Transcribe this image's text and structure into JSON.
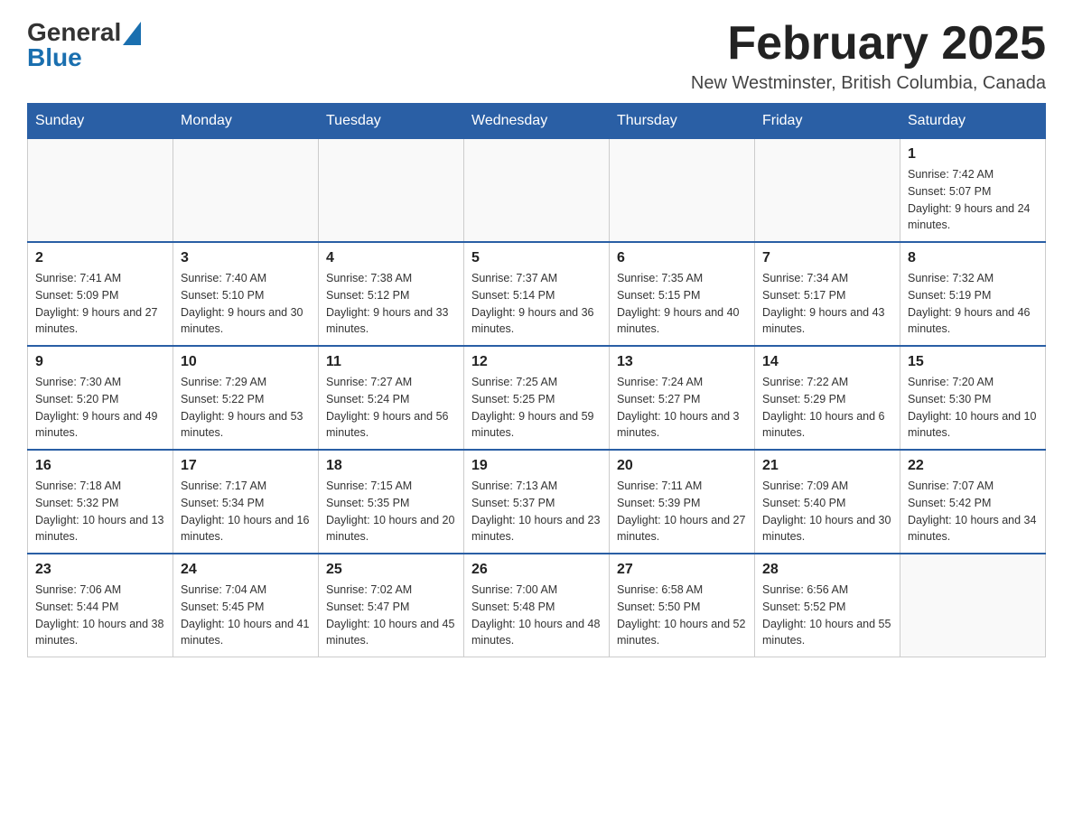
{
  "header": {
    "logo_general": "General",
    "logo_blue": "Blue",
    "title": "February 2025",
    "location": "New Westminster, British Columbia, Canada"
  },
  "days_of_week": [
    "Sunday",
    "Monday",
    "Tuesday",
    "Wednesday",
    "Thursday",
    "Friday",
    "Saturday"
  ],
  "weeks": [
    {
      "days": [
        {
          "num": "",
          "info": ""
        },
        {
          "num": "",
          "info": ""
        },
        {
          "num": "",
          "info": ""
        },
        {
          "num": "",
          "info": ""
        },
        {
          "num": "",
          "info": ""
        },
        {
          "num": "",
          "info": ""
        },
        {
          "num": "1",
          "info": "Sunrise: 7:42 AM\nSunset: 5:07 PM\nDaylight: 9 hours and 24 minutes."
        }
      ]
    },
    {
      "days": [
        {
          "num": "2",
          "info": "Sunrise: 7:41 AM\nSunset: 5:09 PM\nDaylight: 9 hours and 27 minutes."
        },
        {
          "num": "3",
          "info": "Sunrise: 7:40 AM\nSunset: 5:10 PM\nDaylight: 9 hours and 30 minutes."
        },
        {
          "num": "4",
          "info": "Sunrise: 7:38 AM\nSunset: 5:12 PM\nDaylight: 9 hours and 33 minutes."
        },
        {
          "num": "5",
          "info": "Sunrise: 7:37 AM\nSunset: 5:14 PM\nDaylight: 9 hours and 36 minutes."
        },
        {
          "num": "6",
          "info": "Sunrise: 7:35 AM\nSunset: 5:15 PM\nDaylight: 9 hours and 40 minutes."
        },
        {
          "num": "7",
          "info": "Sunrise: 7:34 AM\nSunset: 5:17 PM\nDaylight: 9 hours and 43 minutes."
        },
        {
          "num": "8",
          "info": "Sunrise: 7:32 AM\nSunset: 5:19 PM\nDaylight: 9 hours and 46 minutes."
        }
      ]
    },
    {
      "days": [
        {
          "num": "9",
          "info": "Sunrise: 7:30 AM\nSunset: 5:20 PM\nDaylight: 9 hours and 49 minutes."
        },
        {
          "num": "10",
          "info": "Sunrise: 7:29 AM\nSunset: 5:22 PM\nDaylight: 9 hours and 53 minutes."
        },
        {
          "num": "11",
          "info": "Sunrise: 7:27 AM\nSunset: 5:24 PM\nDaylight: 9 hours and 56 minutes."
        },
        {
          "num": "12",
          "info": "Sunrise: 7:25 AM\nSunset: 5:25 PM\nDaylight: 9 hours and 59 minutes."
        },
        {
          "num": "13",
          "info": "Sunrise: 7:24 AM\nSunset: 5:27 PM\nDaylight: 10 hours and 3 minutes."
        },
        {
          "num": "14",
          "info": "Sunrise: 7:22 AM\nSunset: 5:29 PM\nDaylight: 10 hours and 6 minutes."
        },
        {
          "num": "15",
          "info": "Sunrise: 7:20 AM\nSunset: 5:30 PM\nDaylight: 10 hours and 10 minutes."
        }
      ]
    },
    {
      "days": [
        {
          "num": "16",
          "info": "Sunrise: 7:18 AM\nSunset: 5:32 PM\nDaylight: 10 hours and 13 minutes."
        },
        {
          "num": "17",
          "info": "Sunrise: 7:17 AM\nSunset: 5:34 PM\nDaylight: 10 hours and 16 minutes."
        },
        {
          "num": "18",
          "info": "Sunrise: 7:15 AM\nSunset: 5:35 PM\nDaylight: 10 hours and 20 minutes."
        },
        {
          "num": "19",
          "info": "Sunrise: 7:13 AM\nSunset: 5:37 PM\nDaylight: 10 hours and 23 minutes."
        },
        {
          "num": "20",
          "info": "Sunrise: 7:11 AM\nSunset: 5:39 PM\nDaylight: 10 hours and 27 minutes."
        },
        {
          "num": "21",
          "info": "Sunrise: 7:09 AM\nSunset: 5:40 PM\nDaylight: 10 hours and 30 minutes."
        },
        {
          "num": "22",
          "info": "Sunrise: 7:07 AM\nSunset: 5:42 PM\nDaylight: 10 hours and 34 minutes."
        }
      ]
    },
    {
      "days": [
        {
          "num": "23",
          "info": "Sunrise: 7:06 AM\nSunset: 5:44 PM\nDaylight: 10 hours and 38 minutes."
        },
        {
          "num": "24",
          "info": "Sunrise: 7:04 AM\nSunset: 5:45 PM\nDaylight: 10 hours and 41 minutes."
        },
        {
          "num": "25",
          "info": "Sunrise: 7:02 AM\nSunset: 5:47 PM\nDaylight: 10 hours and 45 minutes."
        },
        {
          "num": "26",
          "info": "Sunrise: 7:00 AM\nSunset: 5:48 PM\nDaylight: 10 hours and 48 minutes."
        },
        {
          "num": "27",
          "info": "Sunrise: 6:58 AM\nSunset: 5:50 PM\nDaylight: 10 hours and 52 minutes."
        },
        {
          "num": "28",
          "info": "Sunrise: 6:56 AM\nSunset: 5:52 PM\nDaylight: 10 hours and 55 minutes."
        },
        {
          "num": "",
          "info": ""
        }
      ]
    }
  ]
}
